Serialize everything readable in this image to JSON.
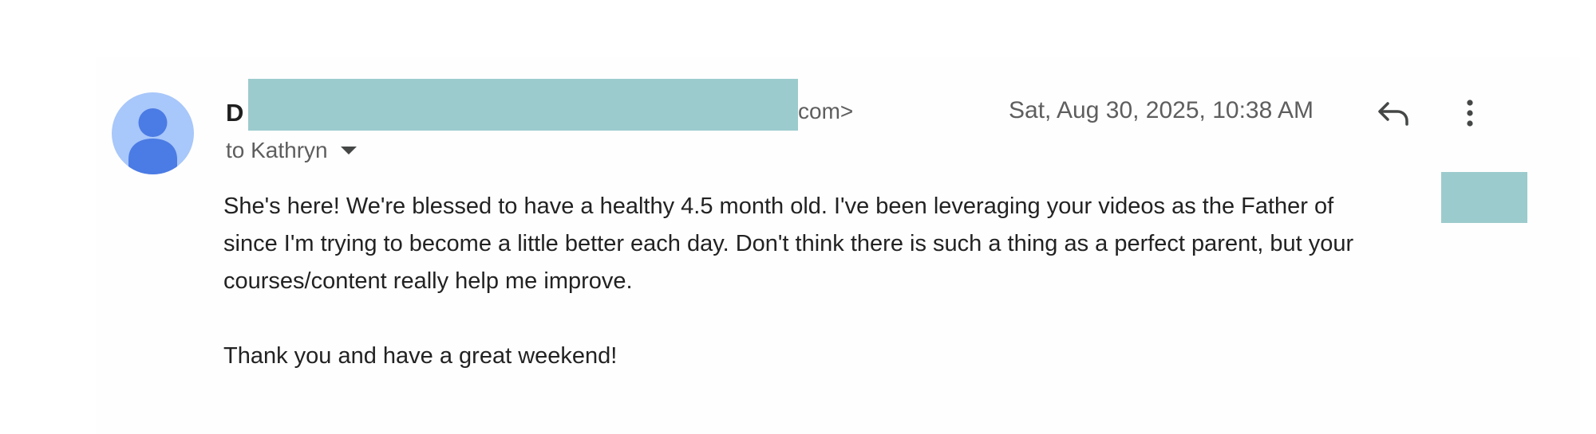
{
  "email": {
    "sender_visible_initial": "D",
    "sender_email_visible_suffix": "com>",
    "to_label": "to Kathryn",
    "timestamp": "Sat, Aug 30, 2025, 10:38 AM",
    "body": {
      "line1": "She's here!  We're blessed to have a healthy 4.5 month old.  I've been leveraging your videos as the Father of",
      "line2": "since I'm trying to become a little better each day.  Don't think there is such a thing as a perfect parent, but your",
      "line3": "courses/content really help me improve.",
      "closing": "Thank you and have a great weekend!"
    }
  },
  "icons": {
    "avatar": "person-avatar-icon",
    "reply": "reply-icon",
    "more": "more-vert-icon",
    "dropdown": "caret-down-icon"
  },
  "colors": {
    "avatar_bg": "#a8c7fa",
    "avatar_fg": "#4b7be4",
    "redaction": "#9ccbcd"
  }
}
